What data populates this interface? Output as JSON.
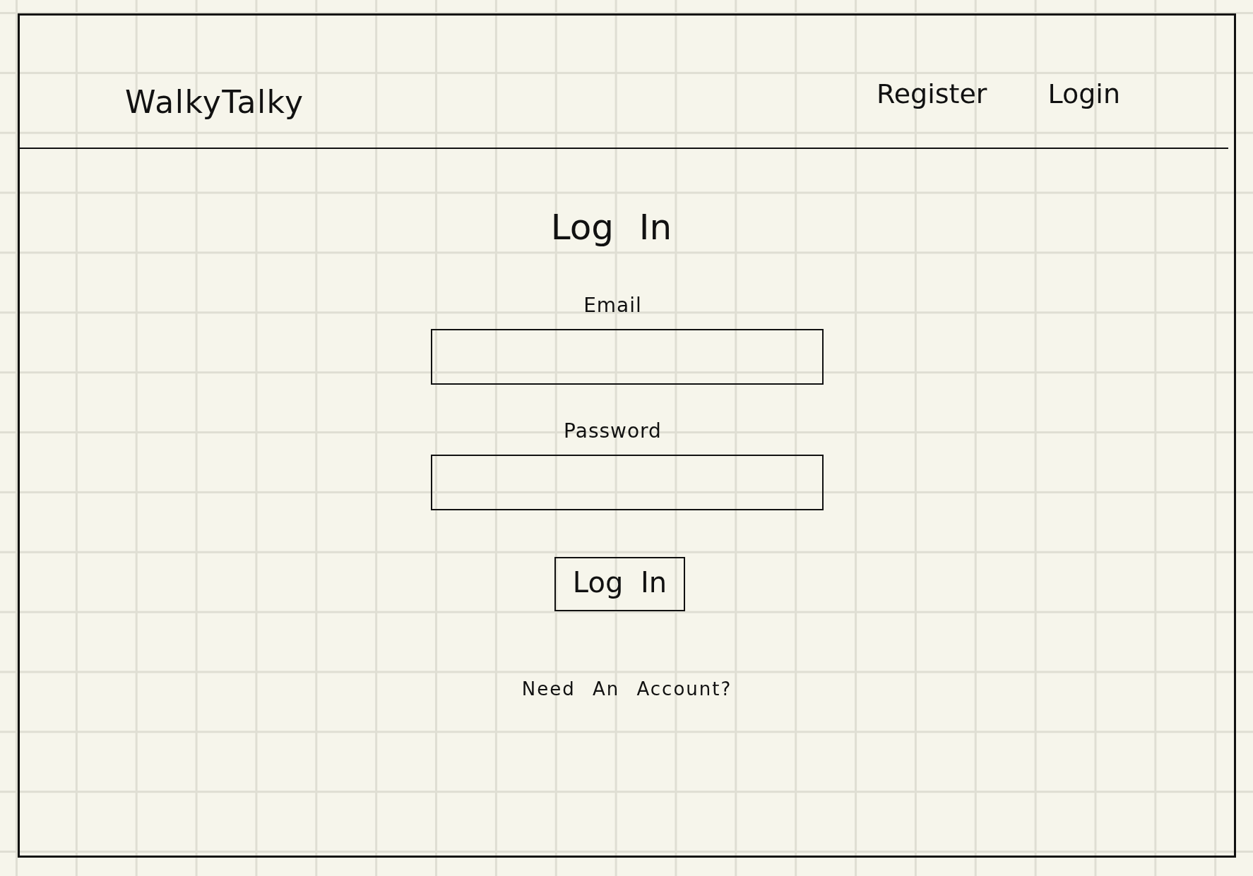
{
  "header": {
    "logo": "WalkyTalky",
    "nav": [
      "Register",
      "Login"
    ]
  },
  "login_form": {
    "title": "Log In",
    "fields": [
      {
        "label": "Email"
      },
      {
        "label": "Password"
      }
    ],
    "submit_button": "Log In",
    "account_link": "Need An Account?"
  }
}
